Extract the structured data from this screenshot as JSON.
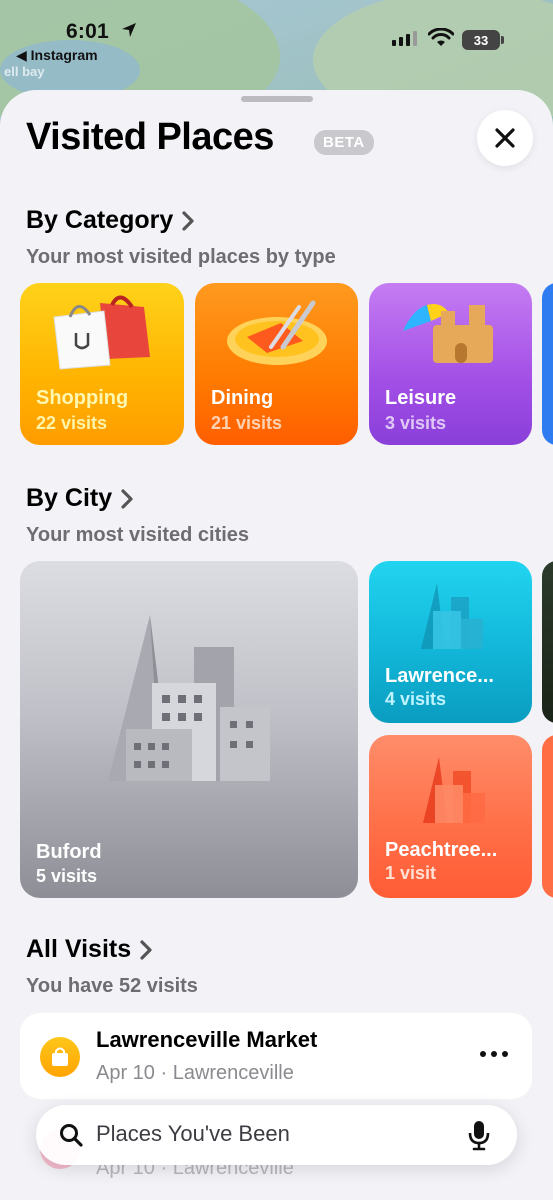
{
  "status_bar": {
    "time": "6:01",
    "back_label": "◀ Instagram",
    "battery": "33"
  },
  "map": {
    "place_label": "ell bay"
  },
  "sheet": {
    "title": "Visited Places",
    "badge": "BETA"
  },
  "by_category": {
    "title": "By Category",
    "subtitle": "Your most visited places by type",
    "items": [
      {
        "name": "Shopping",
        "visits": "22 visits",
        "icon": "shopping-bags-icon"
      },
      {
        "name": "Dining",
        "visits": "21 visits",
        "icon": "plate-fork-knife-icon"
      },
      {
        "name": "Leisure",
        "visits": "3 visits",
        "icon": "sandcastle-umbrella-icon"
      }
    ]
  },
  "by_city": {
    "title": "By City",
    "subtitle": "Your most visited cities",
    "items": [
      {
        "name": "Buford",
        "visits": "5 visits"
      },
      {
        "name": "Lawrence...",
        "visits": "4 visits"
      },
      {
        "name": "Peachtree...",
        "visits": "1 visit"
      }
    ]
  },
  "all_visits": {
    "title": "All Visits",
    "subtitle": "You have 52 visits",
    "items": [
      {
        "name": "Lawrenceville Market",
        "meta": "Apr 10 · Lawrenceville",
        "icon": "shopping-bag-icon"
      },
      {
        "name": "",
        "meta": "Apr 10 · Lawrenceville",
        "icon": "dining-icon"
      }
    ]
  },
  "search": {
    "placeholder": "Places You've Been"
  },
  "colors": {
    "shopping": "#ffb300",
    "dining": "#ff7a00",
    "leisure": "#a24fe6",
    "lawrenceville": "#12b6d8",
    "peachtree": "#ff7048",
    "buford": "#c0c1c8"
  }
}
